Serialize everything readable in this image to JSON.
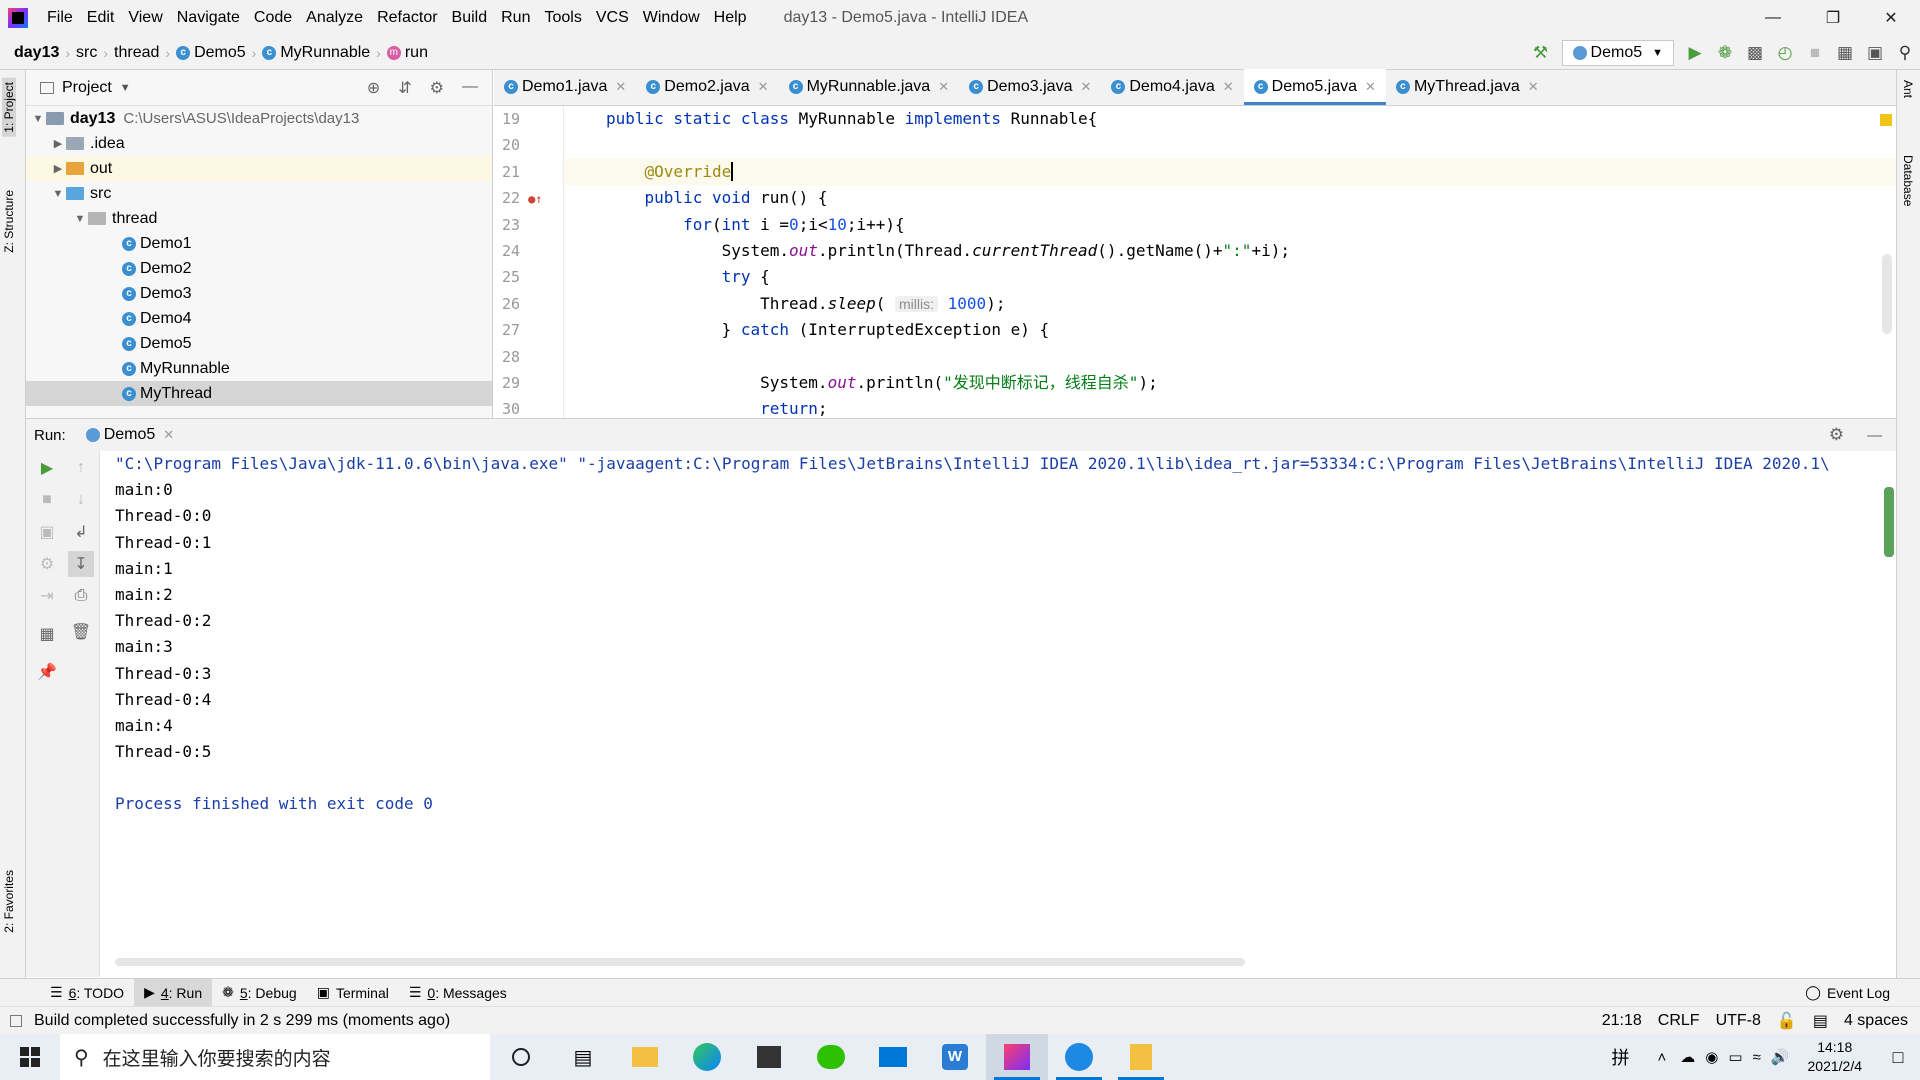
{
  "window": {
    "title": "day13 - Demo5.java - IntelliJ IDEA",
    "menus": [
      "File",
      "Edit",
      "View",
      "Navigate",
      "Code",
      "Analyze",
      "Refactor",
      "Build",
      "Run",
      "Tools",
      "VCS",
      "Window",
      "Help"
    ]
  },
  "breadcrumb": {
    "project": "day13",
    "items": [
      "src",
      "thread",
      "Demo5",
      "MyRunnable",
      "run"
    ]
  },
  "run_config": "Demo5",
  "left_tabs": {
    "project": "1: Project",
    "structure": "Z: Structure",
    "favorites": "2: Favorites"
  },
  "right_tabs": {
    "ant": "Ant",
    "database": "Database"
  },
  "project_panel": {
    "title": "Project",
    "root": {
      "name": "day13",
      "path": "C:\\Users\\ASUS\\IdeaProjects\\day13"
    },
    "folders": {
      "idea": ".idea",
      "out": "out",
      "src": "src",
      "thread": "thread"
    },
    "files": [
      "Demo1",
      "Demo2",
      "Demo3",
      "Demo4",
      "Demo5",
      "MyRunnable",
      "MyThread"
    ]
  },
  "editor": {
    "tabs": [
      "Demo1.java",
      "Demo2.java",
      "MyRunnable.java",
      "Demo3.java",
      "Demo4.java",
      "Demo5.java",
      "MyThread.java"
    ],
    "active_tab": "Demo5.java",
    "line_numbers": [
      "19",
      "20",
      "21",
      "22",
      "23",
      "24",
      "25",
      "26",
      "27",
      "28",
      "29",
      "30"
    ],
    "code": {
      "l19": {
        "kw1": "public static class ",
        "name": "MyRunnable ",
        "kw2": "implements ",
        "rest": "Runnable{"
      },
      "l21": "@Override",
      "l22": {
        "kw": "public void ",
        "rest": "run() {"
      },
      "l23": {
        "kw1": "for",
        "p1": "(",
        "kw2": "int",
        "p2": " i =",
        "n1": "0",
        "p3": ";i<",
        "n2": "10",
        "p4": ";i++){"
      },
      "l24": {
        "p1": "System.",
        "f1": "out",
        "p2": ".println(Thread.",
        "m1": "currentThread",
        "p3": "().getName()+",
        "s1": "\":\"",
        "p4": "+i);"
      },
      "l25": {
        "kw": "try",
        "rest": " {"
      },
      "l26": {
        "p1": "Thread.",
        "m1": "sleep",
        "p2": "(",
        "hint": "millis:",
        "n1": "1000",
        "p3": ");"
      },
      "l27": {
        "p1": "} ",
        "kw": "catch",
        "p2": " (InterruptedException e) {"
      },
      "l29": {
        "p1": "System.",
        "f1": "out",
        "p2": ".println(",
        "s1": "\"发现中断标记，线程自杀\"",
        "p3": ");"
      },
      "l30": {
        "kw": "return",
        "p1": ";"
      }
    }
  },
  "run_panel": {
    "label": "Run:",
    "tab": "Demo5",
    "console": [
      "\"C:\\Program Files\\Java\\jdk-11.0.6\\bin\\java.exe\" \"-javaagent:C:\\Program Files\\JetBrains\\IntelliJ IDEA 2020.1\\lib\\idea_rt.jar=53334:C:\\Program Files\\JetBrains\\IntelliJ IDEA 2020.1\\",
      "main:0",
      "Thread-0:0",
      "Thread-0:1",
      "main:1",
      "main:2",
      "Thread-0:2",
      "main:3",
      "Thread-0:3",
      "Thread-0:4",
      "main:4",
      "Thread-0:5",
      "",
      "Process finished with exit code 0"
    ]
  },
  "bottom_tabs": [
    {
      "num": "6",
      "label": ": TODO"
    },
    {
      "num": "4",
      "label": ": Run"
    },
    {
      "num": "5",
      "label": ": Debug"
    },
    {
      "num": "",
      "label": "Terminal"
    },
    {
      "num": "0",
      "label": ": Messages"
    }
  ],
  "event_log": "Event Log",
  "status": {
    "message": "Build completed successfully in 2 s 299 ms (moments ago)",
    "position": "21:18",
    "line_sep": "CRLF",
    "encoding": "UTF-8",
    "indent": "4 spaces"
  },
  "taskbar": {
    "search_placeholder": "在这里输入你要搜索的内容",
    "ime": "拼",
    "time": "14:18",
    "date": "2021/2/4"
  }
}
